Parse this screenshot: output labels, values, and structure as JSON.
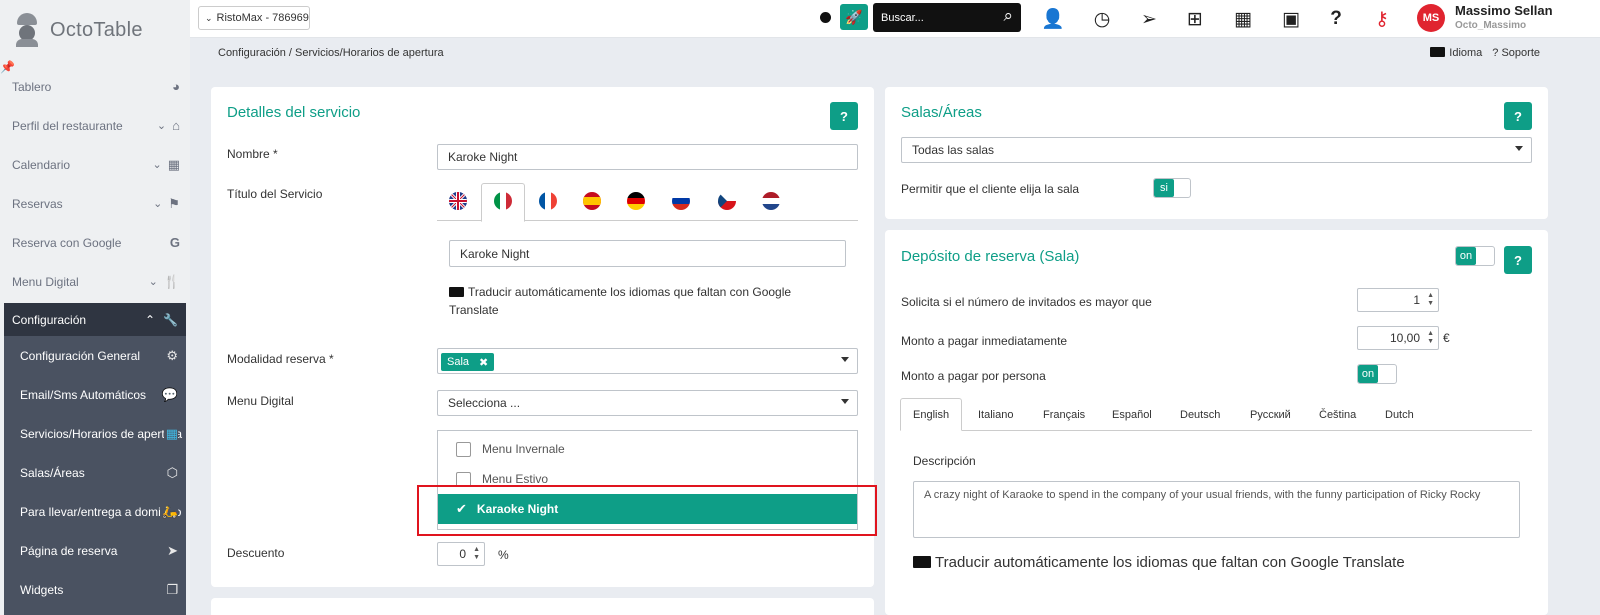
{
  "sidebar": {
    "brand": "OctoTable",
    "items": [
      {
        "label": "Tablero"
      },
      {
        "label": "Perfil del restaurante"
      },
      {
        "label": "Calendario"
      },
      {
        "label": "Reservas"
      },
      {
        "label": "Reserva con Google"
      },
      {
        "label": "Menu Digital"
      }
    ],
    "config_label": "Configuración",
    "sub_items": [
      {
        "label": "Configuración General"
      },
      {
        "label": "Email/Sms Automáticos"
      },
      {
        "label": "Servicios/Horarios de apertura"
      },
      {
        "label": "Salas/Áreas"
      },
      {
        "label": "Para llevar/entrega a domicilio"
      },
      {
        "label": "Página de reserva"
      },
      {
        "label": "Widgets"
      }
    ]
  },
  "topbar": {
    "store": "RistoMax - 786969",
    "search_placeholder": "Buscar...",
    "avatar_initials": "MS",
    "user_name": "Massimo Sellan",
    "user_handle": "Octo_Massimo",
    "help_label": "?"
  },
  "breadcrumb": {
    "path": "Configuración / Servicios/Horarios de apertura",
    "language": "Idioma",
    "support": "? Soporte"
  },
  "service": {
    "title": "Detalles del servicio",
    "help": "?",
    "name_label": "Nombre *",
    "name_value": "Karoke Night",
    "title_label": "Título del Servicio",
    "title_value": "Karoke Night",
    "translate_note": "Traducir automáticamente los idiomas que faltan con Google Translate",
    "modality_label": "Modalidad reserva *",
    "modality_tag": "Sala",
    "menu_label": "Menu Digital",
    "menu_placeholder": "Selecciona ...",
    "menu_options": [
      {
        "label": "Menu Invernale",
        "selected": false
      },
      {
        "label": "Menu Estivo",
        "selected": false
      },
      {
        "label": "Karaoke Night",
        "selected": true
      }
    ],
    "discount_label": "Descuento",
    "discount_value": "0",
    "discount_unit": "%"
  },
  "rooms": {
    "title": "Salas/Áreas",
    "help": "?",
    "select_value": "Todas las salas",
    "allow_label": "Permitir que el cliente elija la sala",
    "allow_toggle": "si"
  },
  "deposit": {
    "title": "Depósito de reserva (Sala)",
    "help": "?",
    "toggle": "on",
    "guests_label": "Solicita si el número de invitados es mayor que",
    "guests_value": "1",
    "amount_label": "Monto a pagar inmediatamente",
    "amount_value": "10,00",
    "currency": "€",
    "per_person_label": "Monto a pagar por persona",
    "per_person_toggle": "on",
    "tabs": [
      "English",
      "Italiano",
      "Français",
      "Español",
      "Deutsch",
      "Русский",
      "Čeština",
      "Dutch"
    ],
    "description_label": "Descripción",
    "description_value": "A crazy night of Karaoke to spend in the company of your usual friends, with the funny participation of Ricky Rocky",
    "translate_note": "Traducir automáticamente los idiomas que faltan con Google Translate"
  },
  "colors": {
    "accent": "#0e9e87",
    "highlight": "#e0141e",
    "sidebar_dark": "#2f3541"
  }
}
